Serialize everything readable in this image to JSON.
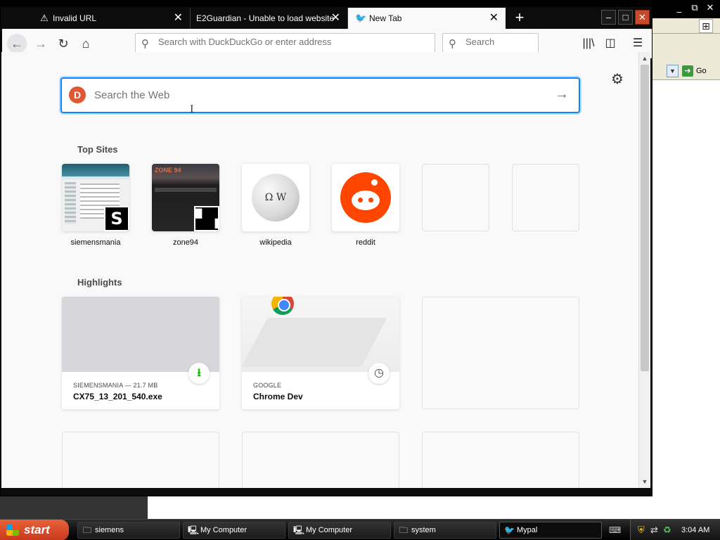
{
  "background_window": {
    "controls": [
      "_",
      "⧉",
      "✕"
    ],
    "go_label": "Go"
  },
  "tabs": [
    {
      "title": "Invalid URL",
      "icon": "warning-icon",
      "active": false
    },
    {
      "title": "E2Guardian - Unable to load website",
      "icon": "none",
      "active": false
    },
    {
      "title": "New Tab",
      "icon": "mypal-icon",
      "active": true
    }
  ],
  "urlbar": {
    "placeholder": "Search with DuckDuckGo or enter address"
  },
  "searchbar": {
    "placeholder": "Search"
  },
  "newtab": {
    "search_placeholder": "Search the Web",
    "top_sites_title": "Top Sites",
    "top_sites": [
      {
        "label": "siemensmania"
      },
      {
        "label": "zone94"
      },
      {
        "label": "wikipedia"
      },
      {
        "label": "reddit"
      }
    ],
    "highlights_title": "Highlights",
    "highlights": [
      {
        "meta": "SIEMENSMANIA — 21.7 MB",
        "title": "CX75_13_201_540.exe",
        "badge": "download-icon"
      },
      {
        "meta": "GOOGLE",
        "title": "Chrome Dev",
        "badge": "history-icon"
      }
    ]
  },
  "taskbar": {
    "start_label": "start",
    "items": [
      {
        "label": "siemens",
        "icon": "folder-icon"
      },
      {
        "label": "My Computer",
        "icon": "computer-icon"
      },
      {
        "label": "My Computer",
        "icon": "computer-icon"
      },
      {
        "label": "system",
        "icon": "folder-icon"
      },
      {
        "label": "Mypal",
        "icon": "mypal-icon",
        "active": true
      }
    ],
    "clock": "3:04 AM"
  },
  "colors": {
    "accent": "#0a84ff",
    "tab_bar": "#0c0c0c",
    "content_bg": "#f9f9fa",
    "reddit": "#ff4500",
    "duckduckgo": "#de5833",
    "download_green": "#12bc00"
  }
}
